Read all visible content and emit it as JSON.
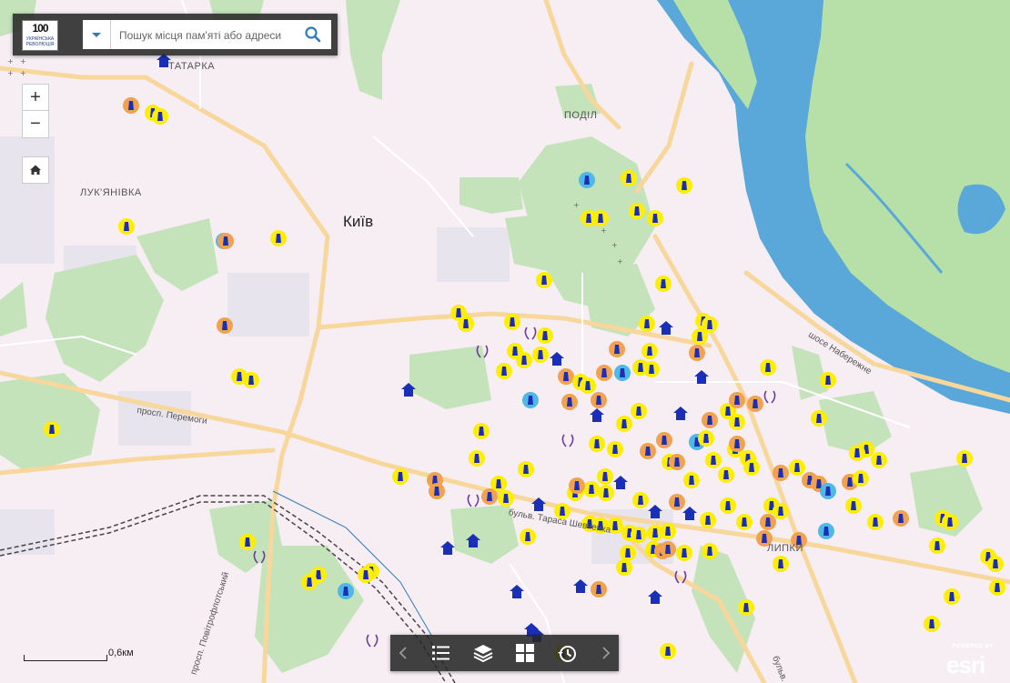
{
  "search": {
    "placeholder": "Пошук місця пам'яті або адреси"
  },
  "logo": {
    "mark": "100",
    "subtitle": "УКРАЇНСЬКА РЕВОЛЮЦІЯ"
  },
  "zoom": {
    "in_label": "+",
    "out_label": "−"
  },
  "map": {
    "city_label": "Київ",
    "places": [
      {
        "id": "tatarka",
        "label": "ТАТАРКА"
      },
      {
        "id": "podil",
        "label": "ПОДІЛ"
      },
      {
        "id": "lukianivka",
        "label": "ЛУК'ЯНІВКА"
      },
      {
        "id": "lypky",
        "label": "ЛИПКИ"
      }
    ],
    "roads": [
      {
        "id": "peremohy",
        "label": "просп. Перемоги"
      },
      {
        "id": "naberezhne",
        "label": "шосе Набережне"
      },
      {
        "id": "shevchenka",
        "label": "бульв. Тараса Шевченка"
      },
      {
        "id": "povitroflotskyi",
        "label": "просп. Повітрофлотський"
      },
      {
        "id": "bulv",
        "label": "бульв."
      }
    ],
    "scale_label": "0,6км",
    "colors": {
      "land": "#f6eef3",
      "water": "#5aa7da",
      "park": "#c4e3bb",
      "road": "#f7d79b",
      "marker_yellow": "#ffee00",
      "marker_orange": "#f2a24e",
      "marker_cyan": "#4fb8e6",
      "marker_blue": "#1a2fb8"
    }
  },
  "toolbar": {
    "buttons": [
      {
        "id": "prev",
        "icon": "chevron-left-icon"
      },
      {
        "id": "legend",
        "icon": "list-icon"
      },
      {
        "id": "layers",
        "icon": "layers-icon"
      },
      {
        "id": "basemap",
        "icon": "grid-icon"
      },
      {
        "id": "history",
        "icon": "history-icon"
      },
      {
        "id": "next",
        "icon": "chevron-right-icon"
      }
    ]
  },
  "attribution": {
    "powered_by": "POWERED BY",
    "brand": "esri"
  }
}
